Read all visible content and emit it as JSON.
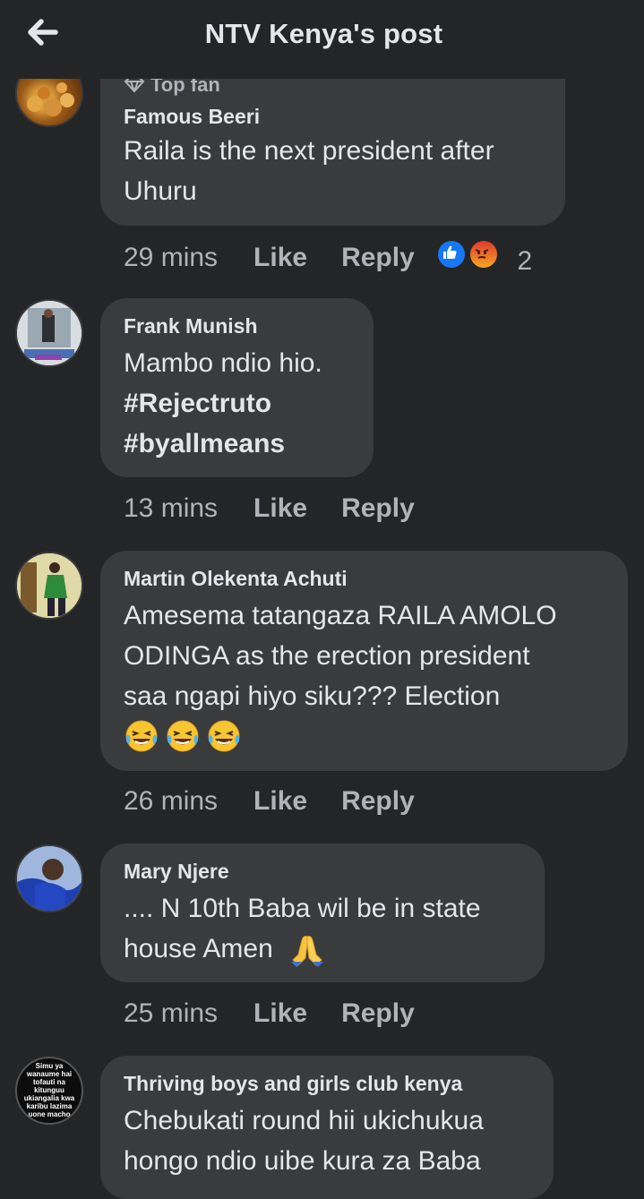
{
  "header": {
    "title": "NTV Kenya's post"
  },
  "comments": [
    {
      "badge": "Top fan",
      "author": "Famous Beeri",
      "lines": [
        "Raila is the next president after",
        "Uhuru"
      ],
      "time": "29 mins",
      "like_label": "Like",
      "reply_label": "Reply",
      "reactions": [
        "like",
        "angry"
      ],
      "reaction_count": "2"
    },
    {
      "author": "Frank Munish",
      "text": "Mambo ndio hio.",
      "hashtags": [
        "#Rejectruto",
        "#byallmeans"
      ],
      "time": "13 mins",
      "like_label": "Like",
      "reply_label": "Reply"
    },
    {
      "author": "Martin Olekenta Achuti",
      "lines": [
        "Amesema tatangaza RAILA AMOLO",
        "ODINGA as the erection president",
        "saa ngapi hiyo siku??? Election"
      ],
      "emojis": [
        "laughing-tears",
        "laughing-tears",
        "laughing-tears"
      ],
      "time": "26 mins",
      "like_label": "Like",
      "reply_label": "Reply"
    },
    {
      "author": "Mary Njere",
      "lines": [
        ".... N 10th Baba wil be in state",
        "house Amen"
      ],
      "emojis": [
        "folded-hands"
      ],
      "time": "25 mins",
      "like_label": "Like",
      "reply_label": "Reply"
    },
    {
      "author": "Thriving boys and girls club kenya",
      "avatar_text": "Simu ya wanaume hai tofauti na kitunguu ukiangalia kwa karibu lazima uone macho",
      "lines": [
        "Chebukati round hii ukichukua",
        "hongo ndio uibe kura za Baba"
      ]
    }
  ],
  "colors": {
    "background": "#242526",
    "bubble": "#3a3b3c",
    "text": "#e4e6eb",
    "muted": "#b0b3b8",
    "like_blue": "#1877f2",
    "angry_orange": "#f0622b"
  }
}
